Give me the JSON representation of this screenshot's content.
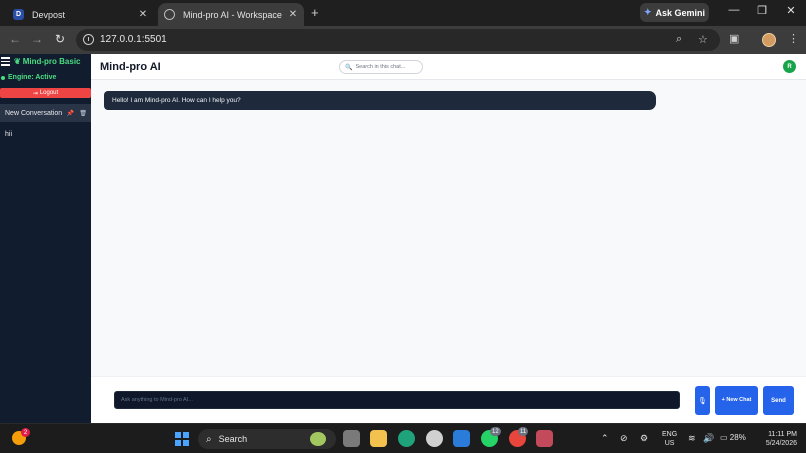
{
  "browser": {
    "tabs": [
      {
        "label": "Devpost",
        "favicon": "D"
      },
      {
        "label": "Mind-pro AI - Workspace",
        "active": true
      }
    ],
    "tab_close": "✕",
    "new_tab": "+",
    "ask_gemini": "Ask Gemini",
    "url": "127.0.0.1:5501"
  },
  "sidebar": {
    "brand": "Mind-pro Basic",
    "engine_status": "Engine: Active",
    "logout": "Logout",
    "conversation": "New Conversation",
    "history": [
      "hii"
    ]
  },
  "header": {
    "title": "Mind-pro AI",
    "search_placeholder": "Search in this chat...",
    "avatar_initial": "R"
  },
  "chat": {
    "messages": [
      {
        "role": "assistant",
        "text": "Hello! I am Mind-pro AI. How can I help you?"
      }
    ]
  },
  "composer": {
    "placeholder": "Ask anything to Mind-pro AI...",
    "mic": "🎙",
    "new_chat": "+ New Chat",
    "send": "Send"
  },
  "taskbar": {
    "search": "Search",
    "weather_badge": "2",
    "whatsapp_badge": "12",
    "chrome_badge": "11",
    "lang_line1": "ENG",
    "lang_line2": "US",
    "battery": "28%",
    "time": "11:11 PM",
    "date": "5/24/2026"
  },
  "colors": {
    "sidebar_bg": "#111c2e",
    "accent_green": "#4ade80",
    "logout_red": "#ef4444",
    "primary_blue": "#2563eb",
    "bubble_bg": "#1e293b"
  }
}
